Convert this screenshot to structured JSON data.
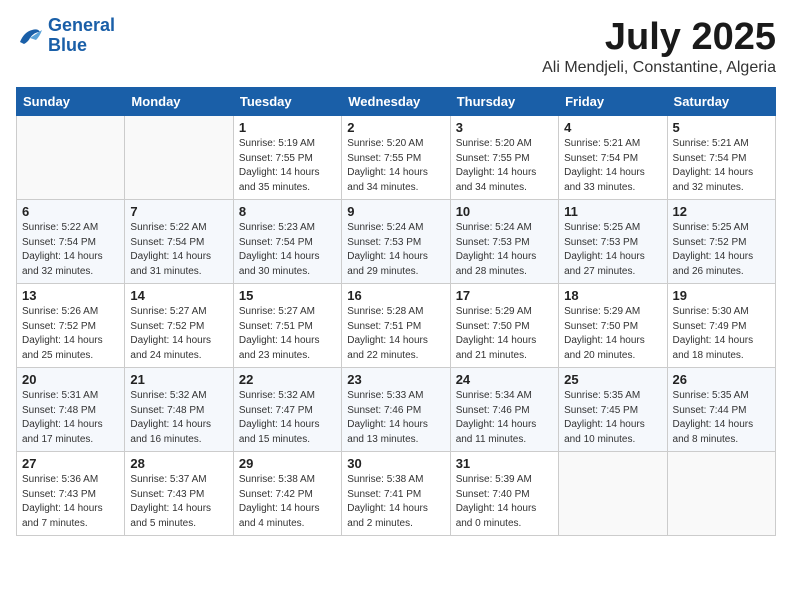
{
  "header": {
    "logo_line1": "General",
    "logo_line2": "Blue",
    "title": "July 2025",
    "subtitle": "Ali Mendjeli, Constantine, Algeria"
  },
  "weekdays": [
    "Sunday",
    "Monday",
    "Tuesday",
    "Wednesday",
    "Thursday",
    "Friday",
    "Saturday"
  ],
  "weeks": [
    [
      {
        "day": "",
        "info": ""
      },
      {
        "day": "",
        "info": ""
      },
      {
        "day": "1",
        "info": "Sunrise: 5:19 AM\nSunset: 7:55 PM\nDaylight: 14 hours\nand 35 minutes."
      },
      {
        "day": "2",
        "info": "Sunrise: 5:20 AM\nSunset: 7:55 PM\nDaylight: 14 hours\nand 34 minutes."
      },
      {
        "day": "3",
        "info": "Sunrise: 5:20 AM\nSunset: 7:55 PM\nDaylight: 14 hours\nand 34 minutes."
      },
      {
        "day": "4",
        "info": "Sunrise: 5:21 AM\nSunset: 7:54 PM\nDaylight: 14 hours\nand 33 minutes."
      },
      {
        "day": "5",
        "info": "Sunrise: 5:21 AM\nSunset: 7:54 PM\nDaylight: 14 hours\nand 32 minutes."
      }
    ],
    [
      {
        "day": "6",
        "info": "Sunrise: 5:22 AM\nSunset: 7:54 PM\nDaylight: 14 hours\nand 32 minutes."
      },
      {
        "day": "7",
        "info": "Sunrise: 5:22 AM\nSunset: 7:54 PM\nDaylight: 14 hours\nand 31 minutes."
      },
      {
        "day": "8",
        "info": "Sunrise: 5:23 AM\nSunset: 7:54 PM\nDaylight: 14 hours\nand 30 minutes."
      },
      {
        "day": "9",
        "info": "Sunrise: 5:24 AM\nSunset: 7:53 PM\nDaylight: 14 hours\nand 29 minutes."
      },
      {
        "day": "10",
        "info": "Sunrise: 5:24 AM\nSunset: 7:53 PM\nDaylight: 14 hours\nand 28 minutes."
      },
      {
        "day": "11",
        "info": "Sunrise: 5:25 AM\nSunset: 7:53 PM\nDaylight: 14 hours\nand 27 minutes."
      },
      {
        "day": "12",
        "info": "Sunrise: 5:25 AM\nSunset: 7:52 PM\nDaylight: 14 hours\nand 26 minutes."
      }
    ],
    [
      {
        "day": "13",
        "info": "Sunrise: 5:26 AM\nSunset: 7:52 PM\nDaylight: 14 hours\nand 25 minutes."
      },
      {
        "day": "14",
        "info": "Sunrise: 5:27 AM\nSunset: 7:52 PM\nDaylight: 14 hours\nand 24 minutes."
      },
      {
        "day": "15",
        "info": "Sunrise: 5:27 AM\nSunset: 7:51 PM\nDaylight: 14 hours\nand 23 minutes."
      },
      {
        "day": "16",
        "info": "Sunrise: 5:28 AM\nSunset: 7:51 PM\nDaylight: 14 hours\nand 22 minutes."
      },
      {
        "day": "17",
        "info": "Sunrise: 5:29 AM\nSunset: 7:50 PM\nDaylight: 14 hours\nand 21 minutes."
      },
      {
        "day": "18",
        "info": "Sunrise: 5:29 AM\nSunset: 7:50 PM\nDaylight: 14 hours\nand 20 minutes."
      },
      {
        "day": "19",
        "info": "Sunrise: 5:30 AM\nSunset: 7:49 PM\nDaylight: 14 hours\nand 18 minutes."
      }
    ],
    [
      {
        "day": "20",
        "info": "Sunrise: 5:31 AM\nSunset: 7:48 PM\nDaylight: 14 hours\nand 17 minutes."
      },
      {
        "day": "21",
        "info": "Sunrise: 5:32 AM\nSunset: 7:48 PM\nDaylight: 14 hours\nand 16 minutes."
      },
      {
        "day": "22",
        "info": "Sunrise: 5:32 AM\nSunset: 7:47 PM\nDaylight: 14 hours\nand 15 minutes."
      },
      {
        "day": "23",
        "info": "Sunrise: 5:33 AM\nSunset: 7:46 PM\nDaylight: 14 hours\nand 13 minutes."
      },
      {
        "day": "24",
        "info": "Sunrise: 5:34 AM\nSunset: 7:46 PM\nDaylight: 14 hours\nand 11 minutes."
      },
      {
        "day": "25",
        "info": "Sunrise: 5:35 AM\nSunset: 7:45 PM\nDaylight: 14 hours\nand 10 minutes."
      },
      {
        "day": "26",
        "info": "Sunrise: 5:35 AM\nSunset: 7:44 PM\nDaylight: 14 hours\nand 8 minutes."
      }
    ],
    [
      {
        "day": "27",
        "info": "Sunrise: 5:36 AM\nSunset: 7:43 PM\nDaylight: 14 hours\nand 7 minutes."
      },
      {
        "day": "28",
        "info": "Sunrise: 5:37 AM\nSunset: 7:43 PM\nDaylight: 14 hours\nand 5 minutes."
      },
      {
        "day": "29",
        "info": "Sunrise: 5:38 AM\nSunset: 7:42 PM\nDaylight: 14 hours\nand 4 minutes."
      },
      {
        "day": "30",
        "info": "Sunrise: 5:38 AM\nSunset: 7:41 PM\nDaylight: 14 hours\nand 2 minutes."
      },
      {
        "day": "31",
        "info": "Sunrise: 5:39 AM\nSunset: 7:40 PM\nDaylight: 14 hours\nand 0 minutes."
      },
      {
        "day": "",
        "info": ""
      },
      {
        "day": "",
        "info": ""
      }
    ]
  ]
}
